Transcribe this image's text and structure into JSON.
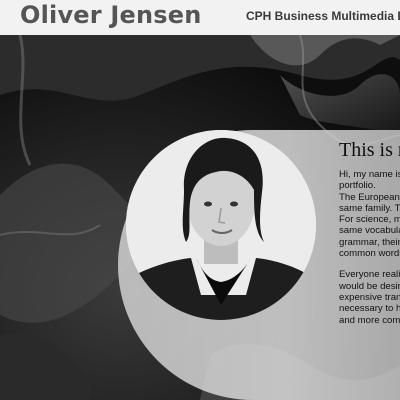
{
  "header": {
    "site_title": "Oliver Jensen",
    "subtitle": "CPH Business Multimedia Des"
  },
  "hero": {
    "portrait_alt": "portrait of Oliver Jensen"
  },
  "intro": {
    "heading": "This is r",
    "paragraphs": [
      {
        "lines": [
          "Hi, my name is",
          "portfolio.",
          "The European l",
          "same family. Th",
          "For science, mu",
          "same vocabula",
          "grammar, their",
          "common words"
        ]
      },
      {
        "lines": [
          "Everyone realiz",
          "would be desira",
          "expensive trans",
          "necessary to ha",
          "and more comm"
        ]
      }
    ]
  }
}
